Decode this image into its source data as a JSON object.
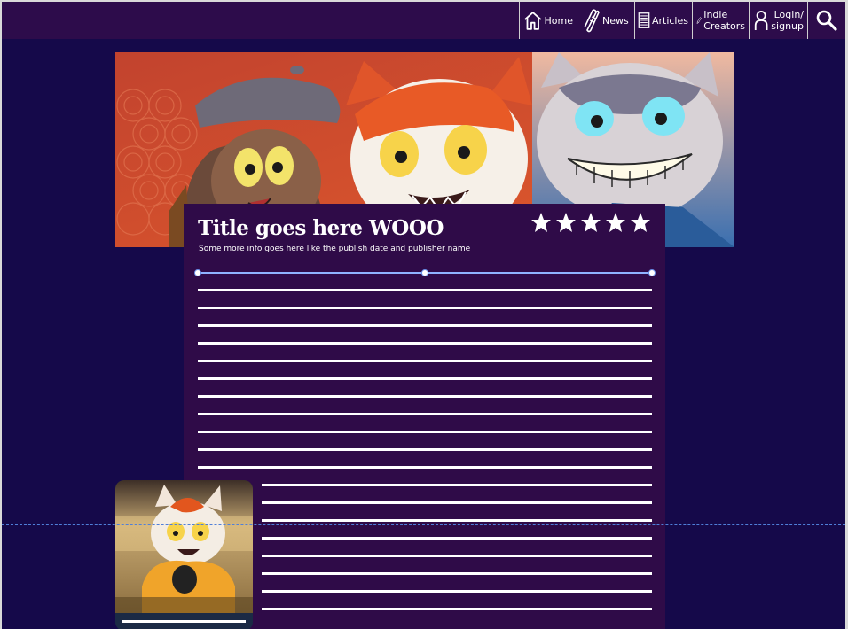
{
  "nav": {
    "home": "Home",
    "news": "News",
    "articles": "Articles",
    "indie_line1": "Indie",
    "indie_line2": "Creators",
    "login_line1": "Login/",
    "login_line2": "signup",
    "icons": [
      "home-icon",
      "news-scroll-icon",
      "articles-icon",
      "pencil-icon",
      "user-icon",
      "search-icon"
    ]
  },
  "article": {
    "title": "Title goes here WOOO",
    "subtitle": "Some more info goes here like the publish date and publisher name",
    "rating_stars": 5,
    "slider_position": 0.5
  },
  "colors": {
    "page_bg": "#15094a",
    "topbar_bg": "#2d0c4b",
    "panel_bg": "#2f0b48",
    "text": "#ffffff",
    "slider_track": "#8fb3ff"
  }
}
